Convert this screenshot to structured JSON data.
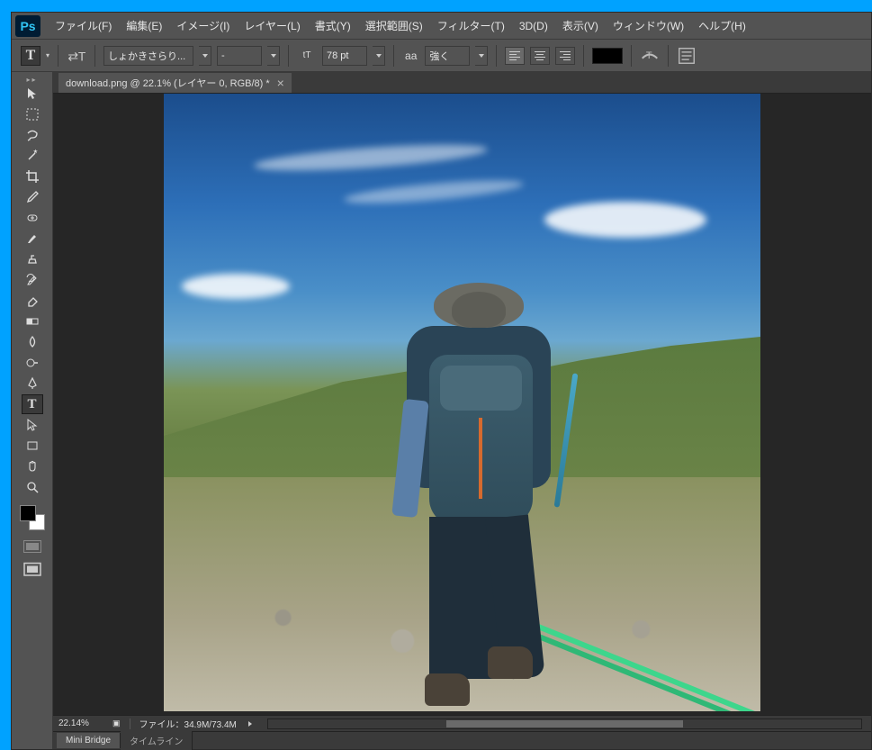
{
  "app": {
    "logo_text": "Ps"
  },
  "menus": {
    "file": "ファイル(F)",
    "edit": "編集(E)",
    "image": "イメージ(I)",
    "layer": "レイヤー(L)",
    "type": "書式(Y)",
    "select": "選択範囲(S)",
    "filter": "フィルター(T)",
    "threeD": "3D(D)",
    "view": "表示(V)",
    "window": "ウィンドウ(W)",
    "help": "ヘルプ(H)"
  },
  "options": {
    "font_family": "しょかきさらり...",
    "font_style": "-",
    "font_size": "78 pt",
    "aa_label": "aa",
    "aa_mode": "強く",
    "color": "#000000"
  },
  "document": {
    "tab_title": "download.png @ 22.1% (レイヤー 0, RGB/8) *"
  },
  "status": {
    "zoom": "22.14%",
    "file_info": "ファイル：34.9M/73.4M"
  },
  "panels": {
    "mini_bridge": "Mini Bridge",
    "timeline": "タイムライン"
  }
}
